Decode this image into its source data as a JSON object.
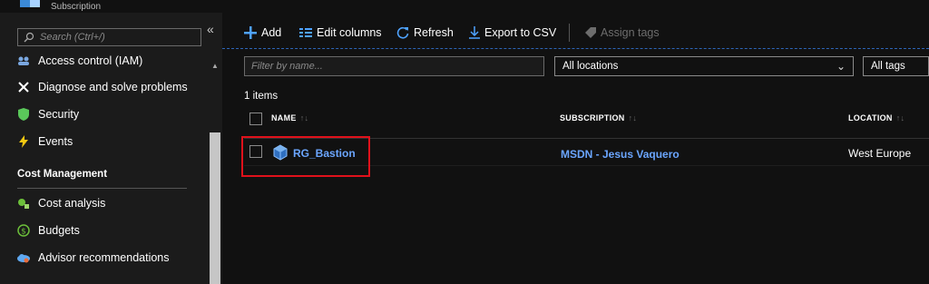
{
  "header": {
    "subtitle": "Subscription"
  },
  "sidebar": {
    "search_placeholder": "Search (Ctrl+/)",
    "collapse": "«",
    "items": [
      {
        "label": "Access control (IAM)",
        "icon": "people-icon"
      },
      {
        "label": "Diagnose and solve problems",
        "icon": "tools-icon"
      },
      {
        "label": "Security",
        "icon": "shield-icon"
      },
      {
        "label": "Events",
        "icon": "lightning-icon"
      }
    ],
    "section_title": "Cost Management",
    "cost_items": [
      {
        "label": "Cost analysis",
        "icon": "cost-analysis-icon"
      },
      {
        "label": "Budgets",
        "icon": "budget-icon"
      },
      {
        "label": "Advisor recommendations",
        "icon": "advisor-cloud-icon"
      }
    ]
  },
  "toolbar": {
    "add": "Add",
    "edit_columns": "Edit columns",
    "refresh": "Refresh",
    "export_csv": "Export to CSV",
    "assign_tags": "Assign tags"
  },
  "filters": {
    "name_placeholder": "Filter by name...",
    "locations": "All locations",
    "tags": "All tags"
  },
  "list": {
    "count": "1 items",
    "columns": {
      "name": "NAME",
      "subscription": "SUBSCRIPTION",
      "location": "LOCATION"
    },
    "rows": [
      {
        "name": "RG_Bastion",
        "subscription": "MSDN - Jesus Vaquero",
        "location": "West Europe"
      }
    ]
  },
  "colors": {
    "accent": "#4fa3ff",
    "link": "#6ba6ff",
    "highlight": "#e0111b",
    "background": "#111111"
  }
}
